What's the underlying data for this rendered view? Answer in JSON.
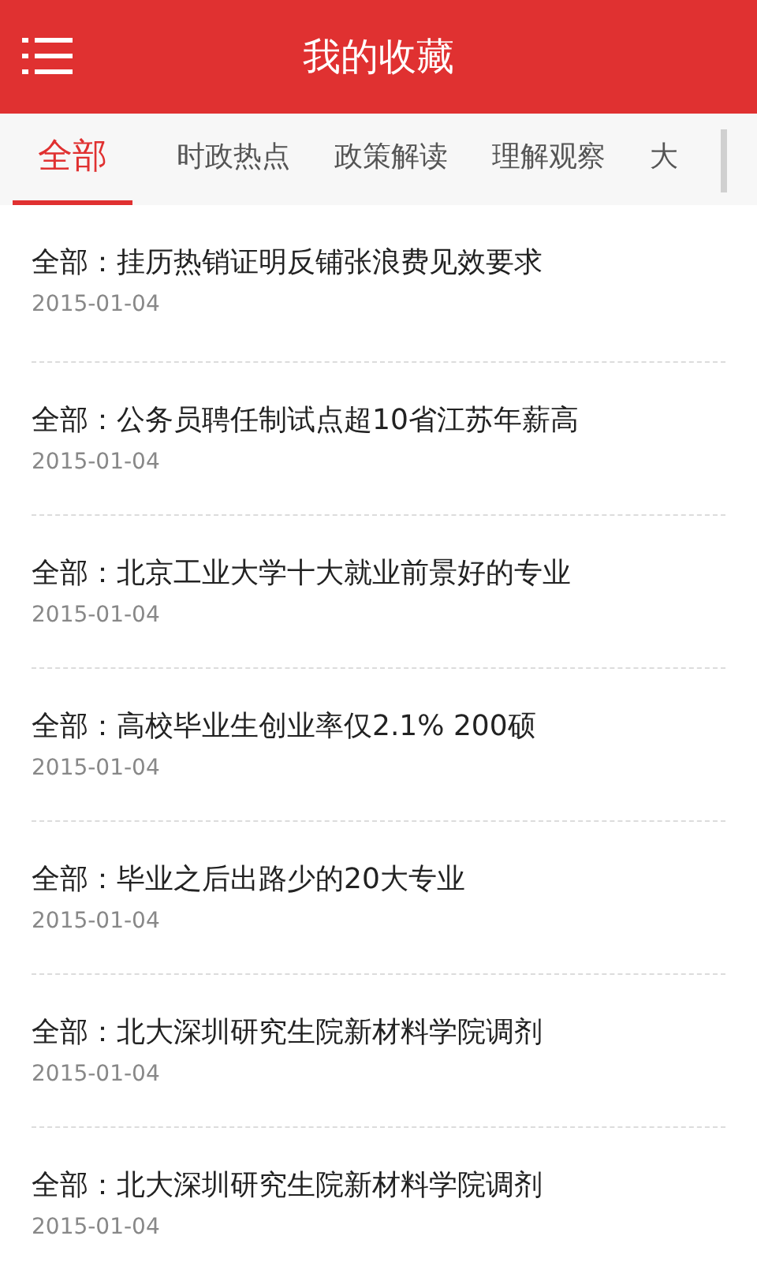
{
  "header": {
    "title": "我的收藏"
  },
  "tabs": [
    {
      "label": "全部",
      "selected": true
    },
    {
      "label": "时政热点",
      "selected": false
    },
    {
      "label": "政策解读",
      "selected": false
    },
    {
      "label": "理解观察",
      "selected": false
    },
    {
      "label": "大",
      "selected": false
    }
  ],
  "items": [
    {
      "title": "全部：挂历热销证明反铺张浪费见效要求",
      "date": "2015-01-04"
    },
    {
      "title": "全部：公务员聘任制试点超10省江苏年薪高",
      "date": "2015-01-04"
    },
    {
      "title": "全部：北京工业大学十大就业前景好的专业",
      "date": "2015-01-04"
    },
    {
      "title": "全部：高校毕业生创业率仅2.1% 200硕",
      "date": "2015-01-04"
    },
    {
      "title": "全部：毕业之后出路少的20大专业",
      "date": "2015-01-04"
    },
    {
      "title": "全部：北大深圳研究生院新材料学院调剂",
      "date": "2015-01-04"
    },
    {
      "title": "全部：北大深圳研究生院新材料学院调剂",
      "date": "2015-01-04"
    }
  ]
}
